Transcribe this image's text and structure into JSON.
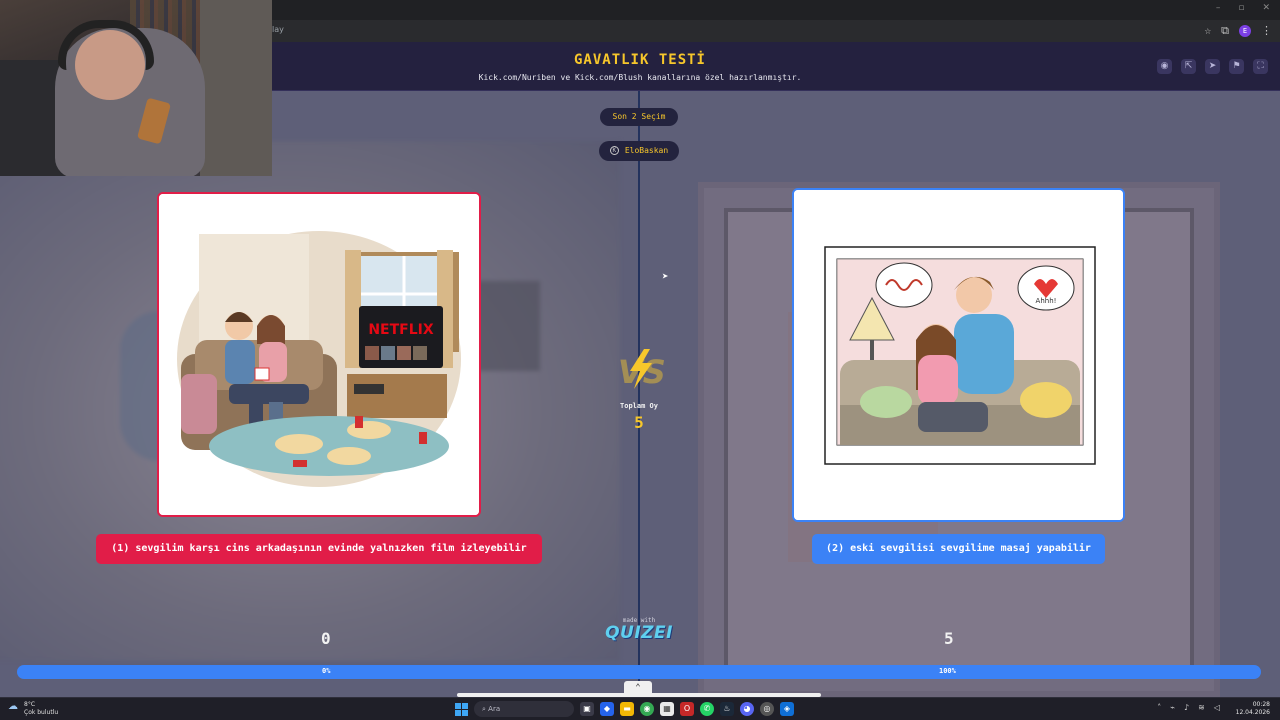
{
  "browser": {
    "url_fragment": "lay",
    "window_controls": [
      "–",
      "▫",
      "✕"
    ],
    "profile_initial": "E"
  },
  "header": {
    "title": "GAVATLIK TESTİ",
    "subtitle": "Kick.com/Nuriben ve Kick.com/Blush kanallarına özel hazırlanmıştır.",
    "icons": [
      "eye-icon",
      "share-icon",
      "send-icon",
      "flag-icon",
      "fullscreen-icon"
    ]
  },
  "quiz": {
    "round_label": "Son 2 Seçim",
    "user_name": "EloBaskan",
    "vs_text": "VS",
    "total_votes_label": "Toplam Oy",
    "total_votes": "5",
    "left": {
      "label": "(1) sevgilim karşı cins arkadaşının evinde yalnızken film izleyebilir",
      "votes": "0",
      "percent_text": "0%",
      "color": "#e11d48"
    },
    "right": {
      "label": "(2) eski sevgilisi sevgilime masaj yapabilir",
      "votes": "5",
      "percent_text": "100%",
      "color": "#3b82f6"
    },
    "left_fraction": 0
  },
  "illustrations": {
    "left_tv_text": "NETFLIX",
    "right_bubble_text": "Ahhh!"
  },
  "branding": {
    "made_with": "made with",
    "logo": "QUIZEI"
  },
  "taskbar": {
    "weather_temp": "8°C",
    "weather_desc": "Çok bulutlu",
    "search_placeholder": "Ara",
    "time": "00:28",
    "date": "12.04.2026"
  }
}
